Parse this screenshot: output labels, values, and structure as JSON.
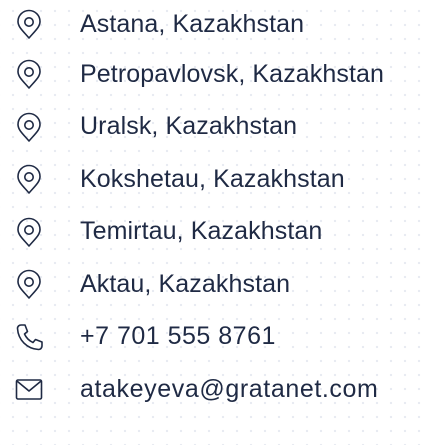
{
  "contacts": {
    "locations": [
      {
        "icon": "location-pin-icon",
        "label": "Astana, Kazakhstan"
      },
      {
        "icon": "location-pin-icon",
        "label": "Petropavlovsk, Kazakhstan"
      },
      {
        "icon": "location-pin-icon",
        "label": "Uralsk, Kazakhstan"
      },
      {
        "icon": "location-pin-icon",
        "label": "Kokshetau, Kazakhstan"
      },
      {
        "icon": "location-pin-icon",
        "label": "Temirtau, Kazakhstan"
      },
      {
        "icon": "location-pin-icon",
        "label": "Aktau, Kazakhstan"
      }
    ],
    "phone": {
      "icon": "phone-icon",
      "label": "+7 701 555 8761"
    },
    "email": {
      "icon": "envelope-icon",
      "label": "atakeyeva@gratanet.com"
    }
  },
  "colors": {
    "text": "#1f2a44",
    "icon": "#1f2a44",
    "background": "#ffffff",
    "dot_pattern": "#e8ebf2"
  }
}
